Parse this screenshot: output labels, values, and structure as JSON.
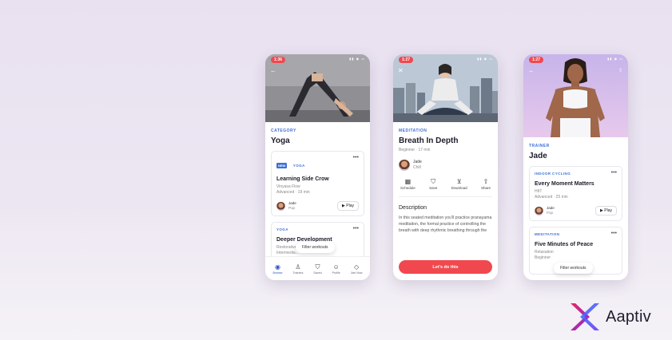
{
  "colors": {
    "accent": "#3d6fd6",
    "cta": "#f0484e",
    "background": "#ece6f2"
  },
  "brand": {
    "name": "Aaptiv"
  },
  "phone1": {
    "time": "1:36",
    "category_kicker": "CATEGORY",
    "category_title": "Yoga",
    "card1": {
      "badge": "NEW",
      "tag": "YOGA",
      "title": "Learning Side Crow",
      "type": "Vinyasa Flow",
      "meta": "Advanced · 19 min",
      "trainer_name": "Jade",
      "trainer_mood": "Pop",
      "play_label": "Play"
    },
    "card2": {
      "tag": "YOGA",
      "title": "Deeper Development",
      "type": "Restorative",
      "meta": "Intermedia..."
    },
    "filter_label": "Filter workouts",
    "tabs": [
      {
        "label": "Browse",
        "icon": "compass-icon"
      },
      {
        "label": "Trainers",
        "icon": "trainers-icon"
      },
      {
        "label": "Saved",
        "icon": "bookmark-icon"
      },
      {
        "label": "Profile",
        "icon": "profile-icon"
      },
      {
        "label": "Join Now",
        "icon": "tag-icon"
      }
    ]
  },
  "phone2": {
    "time": "1:27",
    "kicker": "MEDITATION",
    "title": "Breath In Depth",
    "meta": "Beginner · 17 min",
    "trainer_name": "Jade",
    "trainer_mood": "Chill",
    "actions": [
      {
        "label": "Schedule",
        "icon": "calendar-icon"
      },
      {
        "label": "Save",
        "icon": "bookmark-icon"
      },
      {
        "label": "Download",
        "icon": "download-icon"
      },
      {
        "label": "Share",
        "icon": "share-icon"
      }
    ],
    "description_heading": "Description",
    "description_text": "In this seated meditation you'll practice pranayama meditation, the formal practice of controlling the breath with deep rhythmic breathing through the",
    "cta_label": "Let's do this"
  },
  "phone3": {
    "time": "1:27",
    "kicker": "TRAINER",
    "title": "Jade",
    "card1": {
      "tag": "INDOOR CYCLING",
      "title": "Every Moment Matters",
      "type": "HIIT",
      "meta": "Advanced · 25 min",
      "trainer_name": "Jade",
      "trainer_mood": "Pop",
      "play_label": "Play"
    },
    "card2": {
      "tag": "MEDITATION",
      "title": "Five Minutes of Peace",
      "type": "Relaxation",
      "meta": "Beginner"
    },
    "filter_label": "Filter workouts"
  }
}
